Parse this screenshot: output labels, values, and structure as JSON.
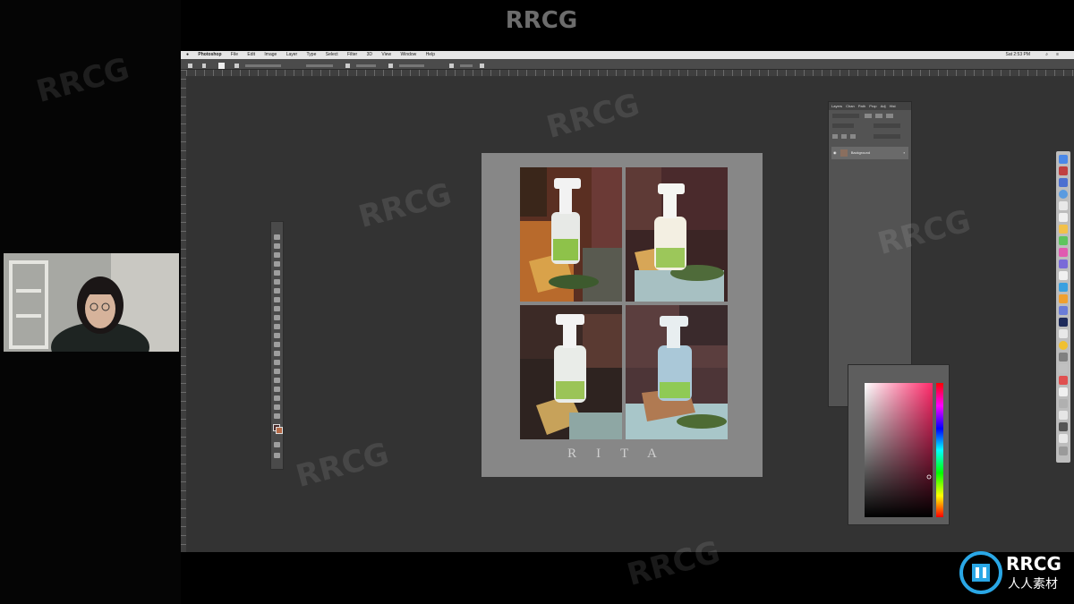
{
  "top_watermark": "RRCG",
  "photoshop": {
    "menu": [
      "Photoshop",
      "File",
      "Edit",
      "Image",
      "Layer",
      "Type",
      "Select",
      "Filter",
      "3D",
      "View",
      "Window",
      "Help"
    ],
    "clock": "Sat 2:53 PM"
  },
  "canvas": {
    "title_text": "RITA"
  },
  "layers_panel": {
    "tabs": [
      "Layers",
      "Chan",
      "Path",
      "Prop",
      "Adj",
      "Hist"
    ],
    "layer_name": "Background"
  },
  "brand": {
    "name": "RRCG",
    "subtitle": "人人素材"
  },
  "colors": {
    "ps_bg": "#333333",
    "doc_bg": "#878787",
    "accent_blue": "#2aa7e6"
  }
}
